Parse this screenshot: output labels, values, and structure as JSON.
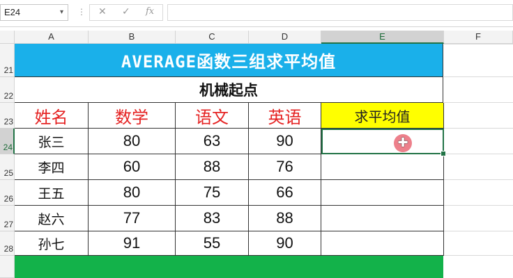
{
  "formula_bar": {
    "name_box": "E24",
    "cancel_glyph": "✕",
    "enter_glyph": "✓",
    "fx_label": "fx",
    "formula": ""
  },
  "columns": [
    "A",
    "B",
    "C",
    "D",
    "E",
    "F"
  ],
  "rows": [
    "21",
    "22",
    "23",
    "24",
    "25",
    "26",
    "27",
    "28"
  ],
  "sheet": {
    "title": "AVERAGE函数三组求平均值",
    "subtitle": "机械起点",
    "headers": [
      "姓名",
      "数学",
      "语文",
      "英语",
      "求平均值"
    ],
    "records": [
      {
        "name": "张三",
        "math": "80",
        "chinese": "63",
        "english": "90",
        "avg": ""
      },
      {
        "name": "李四",
        "math": "60",
        "chinese": "88",
        "english": "76",
        "avg": ""
      },
      {
        "name": "王五",
        "math": "80",
        "chinese": "75",
        "english": "66",
        "avg": ""
      },
      {
        "name": "赵六",
        "math": "77",
        "chinese": "83",
        "english": "88",
        "avg": ""
      },
      {
        "name": "孙七",
        "math": "91",
        "chinese": "55",
        "english": "90",
        "avg": ""
      }
    ]
  },
  "colors": {
    "banner": "#1ab0ea",
    "header_text": "#e52222",
    "avg_header_bg": "#ffff00",
    "footer_band": "#13b24a",
    "selection": "#217346"
  },
  "selected_cell": "E24"
}
